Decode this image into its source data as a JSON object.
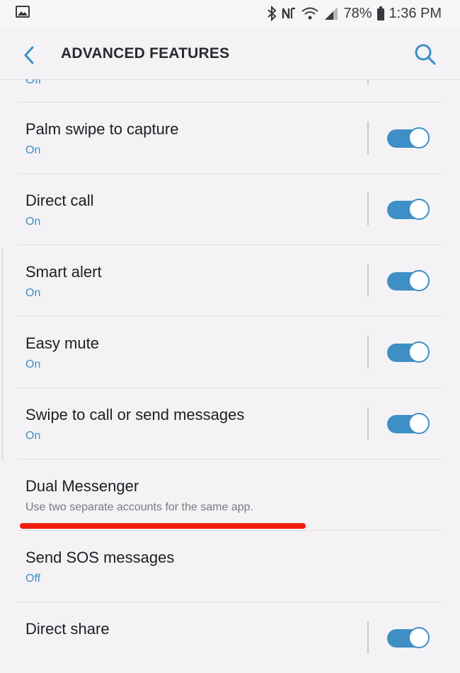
{
  "status_bar": {
    "battery": "78%",
    "time": "1:36 PM",
    "icons": [
      "gallery-icon",
      "bluetooth-icon",
      "nfc-icon",
      "wifi-icon",
      "signal-icon",
      "battery-icon"
    ]
  },
  "app_bar": {
    "title": "ADVANCED FEATURES",
    "back_icon": "chevron-left-icon",
    "search_icon": "search-icon"
  },
  "partial_top_row": {
    "status": "Off"
  },
  "settings": [
    {
      "label": "Palm swipe to capture",
      "status": "On",
      "toggle_on": true
    },
    {
      "label": "Direct call",
      "status": "On",
      "toggle_on": true
    },
    {
      "label": "Smart alert",
      "status": "On",
      "toggle_on": true
    },
    {
      "label": "Easy mute",
      "status": "On",
      "toggle_on": true
    },
    {
      "label": "Swipe to call or send messages",
      "status": "On",
      "toggle_on": true
    },
    {
      "label": "Dual Messenger",
      "description": "Use two separate accounts for the same app."
    },
    {
      "label": "Send SOS messages",
      "status": "Off"
    },
    {
      "label": "Direct share",
      "status": "",
      "toggle_on": true
    }
  ],
  "colors": {
    "accent": "#3d8fc6",
    "background": "#f4f2f5",
    "highlight_underline": "#f01d10"
  }
}
